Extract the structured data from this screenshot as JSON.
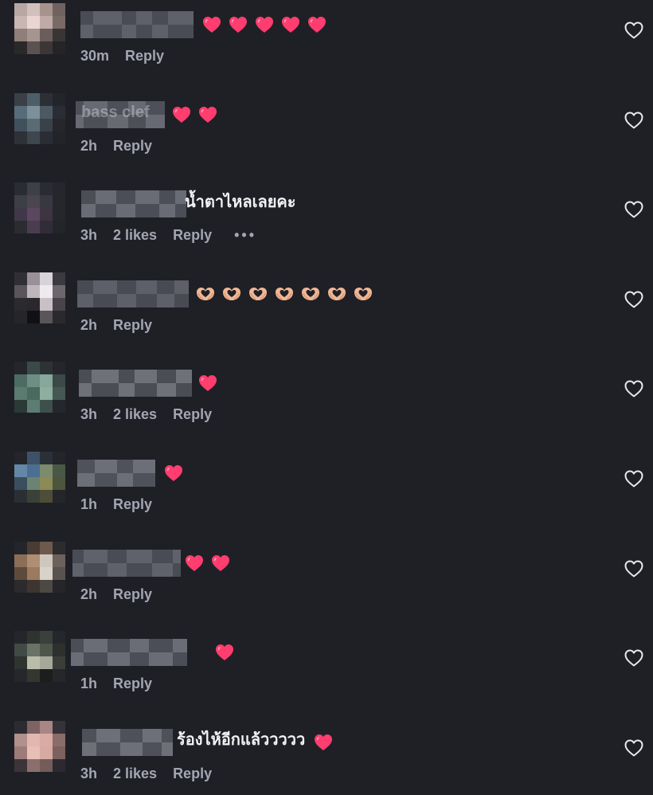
{
  "colors": {
    "background": "#1f2026",
    "text": "#f2f2f5",
    "meta": "#a3a6b2",
    "heart": "#ff3d6e"
  },
  "icons": {
    "like": "heart-outline-icon",
    "emoji_heart": "red-heart-emoji",
    "emoji_hands": "heart-hands-emoji",
    "more": "ellipsis-icon"
  },
  "comments": [
    {
      "time": "30m",
      "likes": "",
      "reply": "Reply",
      "text": "",
      "name_fragment": "",
      "emoji": "heart",
      "emoji_count": 5
    },
    {
      "time": "2h",
      "likes": "",
      "reply": "Reply",
      "text": "",
      "name_fragment": "bass clef",
      "emoji": "heart",
      "emoji_count": 2
    },
    {
      "time": "3h",
      "likes": "2 likes",
      "reply": "Reply",
      "text": "น้ำตาไหลเลยคะ",
      "name_fragment": "",
      "emoji": "",
      "emoji_count": 0,
      "more": "•••"
    },
    {
      "time": "2h",
      "likes": "",
      "reply": "Reply",
      "text": "",
      "name_fragment": "",
      "emoji": "hands",
      "emoji_count": 7
    },
    {
      "time": "3h",
      "likes": "2 likes",
      "reply": "Reply",
      "text": "",
      "name_fragment": "",
      "emoji": "heart",
      "emoji_count": 1
    },
    {
      "time": "1h",
      "likes": "",
      "reply": "Reply",
      "text": "",
      "name_fragment": "",
      "emoji": "heart",
      "emoji_count": 1
    },
    {
      "time": "2h",
      "likes": "",
      "reply": "Reply",
      "text": "",
      "name_fragment": "",
      "emoji": "heart",
      "emoji_count": 2
    },
    {
      "time": "1h",
      "likes": "",
      "reply": "Reply",
      "text": "",
      "name_fragment": "",
      "emoji": "heart",
      "emoji_count": 1
    },
    {
      "time": "3h",
      "likes": "2 likes",
      "reply": "Reply",
      "text": "ร้องไห้อีกแล้ววววว",
      "name_fragment": "",
      "emoji": "heart",
      "emoji_count": 1
    }
  ]
}
